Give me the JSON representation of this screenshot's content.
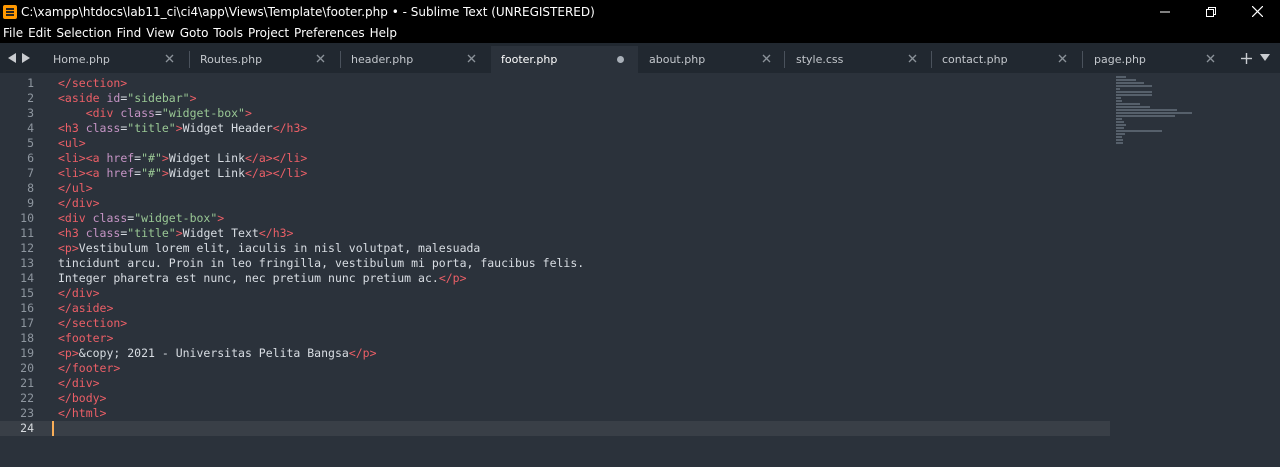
{
  "window": {
    "title": "C:\\xampp\\htdocs\\lab11_ci\\ci4\\app\\Views\\Template\\footer.php • - Sublime Text (UNREGISTERED)"
  },
  "menu": [
    "File",
    "Edit",
    "Selection",
    "Find",
    "View",
    "Goto",
    "Tools",
    "Project",
    "Preferences",
    "Help"
  ],
  "tabs": [
    {
      "label": "Home.php",
      "active": false,
      "modified": false
    },
    {
      "label": "Routes.php",
      "active": false,
      "modified": false
    },
    {
      "label": "header.php",
      "active": false,
      "modified": false
    },
    {
      "label": "footer.php",
      "active": true,
      "modified": true
    },
    {
      "label": "about.php",
      "active": false,
      "modified": false
    },
    {
      "label": "style.css",
      "active": false,
      "modified": false
    },
    {
      "label": "contact.php",
      "active": false,
      "modified": false
    },
    {
      "label": "page.php",
      "active": false,
      "modified": false
    }
  ],
  "editor": {
    "current_line": 24,
    "line_numbers": [
      "1",
      "2",
      "3",
      "4",
      "5",
      "6",
      "7",
      "8",
      "9",
      "10",
      "11",
      "12",
      "13",
      "14",
      "15",
      "16",
      "17",
      "18",
      "19",
      "20",
      "21",
      "22",
      "23",
      "24"
    ],
    "lines": [
      [
        [
          "tag",
          "</section>"
        ]
      ],
      [
        [
          "tag",
          "<aside "
        ],
        [
          "attr",
          "id"
        ],
        [
          "text",
          "="
        ],
        [
          "str",
          "\"sidebar\""
        ],
        [
          "tag",
          ">"
        ]
      ],
      [
        [
          "text",
          "    "
        ],
        [
          "tag",
          "<div "
        ],
        [
          "attr",
          "class"
        ],
        [
          "text",
          "="
        ],
        [
          "str",
          "\"widget-box\""
        ],
        [
          "tag",
          ">"
        ]
      ],
      [
        [
          "tag",
          "<h3 "
        ],
        [
          "attr",
          "class"
        ],
        [
          "text",
          "="
        ],
        [
          "str",
          "\"title\""
        ],
        [
          "tag",
          ">"
        ],
        [
          "text",
          "Widget Header"
        ],
        [
          "tag",
          "</h3>"
        ]
      ],
      [
        [
          "tag",
          "<ul>"
        ]
      ],
      [
        [
          "tag",
          "<li><a "
        ],
        [
          "attr",
          "href"
        ],
        [
          "text",
          "="
        ],
        [
          "str",
          "\"#\""
        ],
        [
          "tag",
          ">"
        ],
        [
          "text",
          "Widget Link"
        ],
        [
          "tag",
          "</a></li>"
        ]
      ],
      [
        [
          "tag",
          "<li><a "
        ],
        [
          "attr",
          "href"
        ],
        [
          "text",
          "="
        ],
        [
          "str",
          "\"#\""
        ],
        [
          "tag",
          ">"
        ],
        [
          "text",
          "Widget Link"
        ],
        [
          "tag",
          "</a></li>"
        ]
      ],
      [
        [
          "tag",
          "</ul>"
        ]
      ],
      [
        [
          "tag",
          "</div>"
        ]
      ],
      [
        [
          "tag",
          "<div "
        ],
        [
          "attr",
          "class"
        ],
        [
          "text",
          "="
        ],
        [
          "str",
          "\"widget-box\""
        ],
        [
          "tag",
          ">"
        ]
      ],
      [
        [
          "tag",
          "<h3 "
        ],
        [
          "attr",
          "class"
        ],
        [
          "text",
          "="
        ],
        [
          "str",
          "\"title\""
        ],
        [
          "tag",
          ">"
        ],
        [
          "text",
          "Widget Text"
        ],
        [
          "tag",
          "</h3>"
        ]
      ],
      [
        [
          "tag",
          "<p>"
        ],
        [
          "text",
          "Vestibulum lorem elit, iaculis in nisl volutpat, malesuada"
        ]
      ],
      [
        [
          "text",
          "tincidunt arcu. Proin in leo fringilla, vestibulum mi porta, faucibus felis."
        ]
      ],
      [
        [
          "text",
          "Integer pharetra est nunc, nec pretium nunc pretium ac."
        ],
        [
          "tag",
          "</p>"
        ]
      ],
      [
        [
          "tag",
          "</div>"
        ]
      ],
      [
        [
          "tag",
          "</aside>"
        ]
      ],
      [
        [
          "tag",
          "</section>"
        ]
      ],
      [
        [
          "tag",
          "<footer>"
        ]
      ],
      [
        [
          "tag",
          "<p>"
        ],
        [
          "text",
          "&copy; 2021 - Universitas Pelita Bangsa"
        ],
        [
          "tag",
          "</p>"
        ]
      ],
      [
        [
          "tag",
          "</footer>"
        ]
      ],
      [
        [
          "tag",
          "</div>"
        ]
      ],
      [
        [
          "tag",
          "</body>"
        ]
      ],
      [
        [
          "tag",
          "</html>"
        ]
      ],
      []
    ]
  },
  "colors": {
    "background": "#2b323b",
    "tag": "#ec5f67",
    "attribute": "#c594c5",
    "string": "#99c794",
    "text": "#d8dde3",
    "cursor": "#f9ae58"
  },
  "icons": {
    "app": "sublime-text-icon",
    "minimize": "minimize-icon",
    "maximize": "restore-icon",
    "close": "close-icon",
    "nav_back": "triangle-left-icon",
    "nav_forward": "triangle-right-icon",
    "new_tab": "plus-icon",
    "tab_menu": "chevron-down-icon"
  }
}
